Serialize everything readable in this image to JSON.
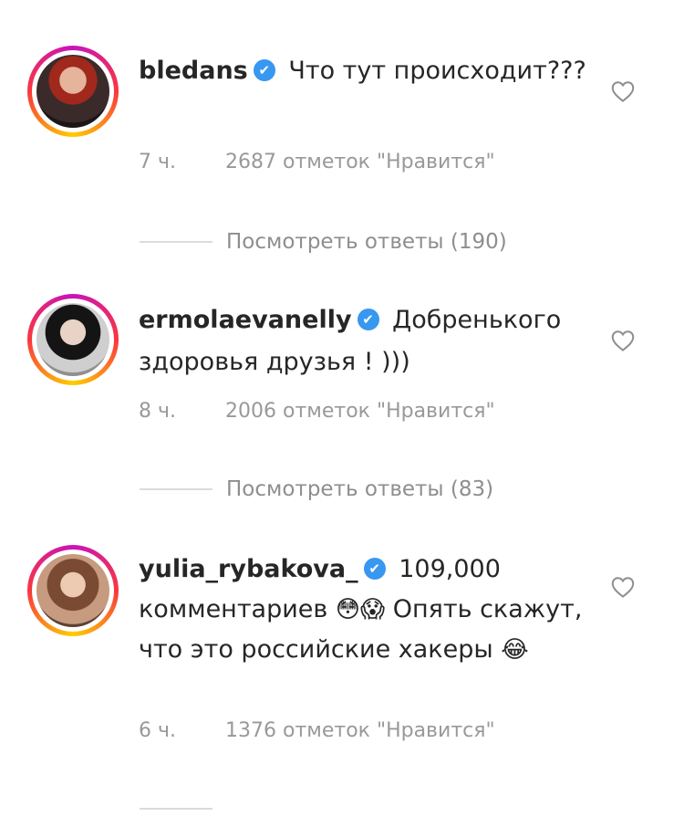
{
  "comments": [
    {
      "username": "bledans",
      "text": "Что тут происходит???",
      "time": "7 ч.",
      "likes": "2687 отметок \"Нравится\"",
      "replies": "Посмотреть ответы (190)"
    },
    {
      "username": "ermolaevanelly",
      "text": "Добренького здоровья друзья ! )))",
      "time": "8 ч.",
      "likes": "2006 отметок \"Нравится\"",
      "replies": "Посмотреть ответы (83)"
    },
    {
      "username": "yulia_rybakova_",
      "text_before": "109,000 комментариев",
      "emoji_a": "😳😱",
      "text_middle": "Опять скажут, что это российские хакеры",
      "emoji_b": "😂",
      "time": "6 ч.",
      "likes": "1376 отметок \"Нравится\""
    }
  ],
  "icons": {
    "verified": "✔",
    "heart": "heart-outline-icon"
  },
  "colors": {
    "verified": "#3897f0",
    "meta_text": "#999999",
    "divider": "#dbdbdb"
  }
}
